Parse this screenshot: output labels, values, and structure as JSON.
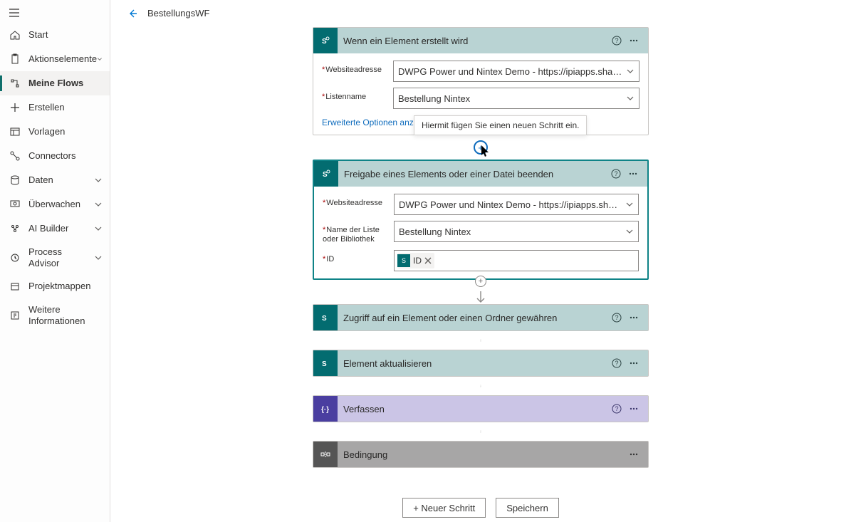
{
  "header": {
    "flow_name": "BestellungsWF"
  },
  "sidebar": {
    "items": [
      {
        "label": "Start",
        "icon": "home"
      },
      {
        "label": "Aktionselemente",
        "icon": "clipboard",
        "expandable": true
      },
      {
        "label": "Meine Flows",
        "icon": "flow",
        "active": true
      },
      {
        "label": "Erstellen",
        "icon": "plus"
      },
      {
        "label": "Vorlagen",
        "icon": "templates"
      },
      {
        "label": "Connectors",
        "icon": "connectors"
      },
      {
        "label": "Daten",
        "icon": "data",
        "expandable": true
      },
      {
        "label": "Überwachen",
        "icon": "monitor",
        "expandable": true
      },
      {
        "label": "AI Builder",
        "icon": "ai",
        "expandable": true
      },
      {
        "label": "Process Advisor",
        "icon": "process",
        "expandable": true
      },
      {
        "label": "Projektmappen",
        "icon": "solutions"
      },
      {
        "label": "Weitere Informationen",
        "icon": "learn"
      }
    ]
  },
  "tooltip": "Hiermit fügen Sie einen neuen Schritt ein.",
  "steps": {
    "trigger": {
      "title": "Wenn ein Element erstellt wird",
      "site_label": "Websiteadresse",
      "site_value": "DWPG Power und Nintex Demo - https://ipiapps.sharepoint.co...",
      "list_label": "Listenname",
      "list_value": "Bestellung Nintex",
      "advanced": "Erweiterte Optionen anzeigen"
    },
    "stop_share": {
      "title": "Freigabe eines Elements oder einer Datei beenden",
      "site_label": "Websiteadresse",
      "site_value": "DWPG Power und Nintex Demo - https://ipiapps.sharepoint.co...",
      "list_label": "Name der Liste oder Bibliothek",
      "list_value": "Bestellung Nintex",
      "id_label": "ID",
      "id_token": "ID"
    },
    "grant": {
      "title": "Zugriff auf ein Element oder einen Ordner gewähren"
    },
    "update": {
      "title": "Element aktualisieren"
    },
    "compose": {
      "title": "Verfassen"
    },
    "condition": {
      "title": "Bedingung"
    }
  },
  "buttons": {
    "new_step": "+ Neuer Schritt",
    "save": "Speichern"
  }
}
